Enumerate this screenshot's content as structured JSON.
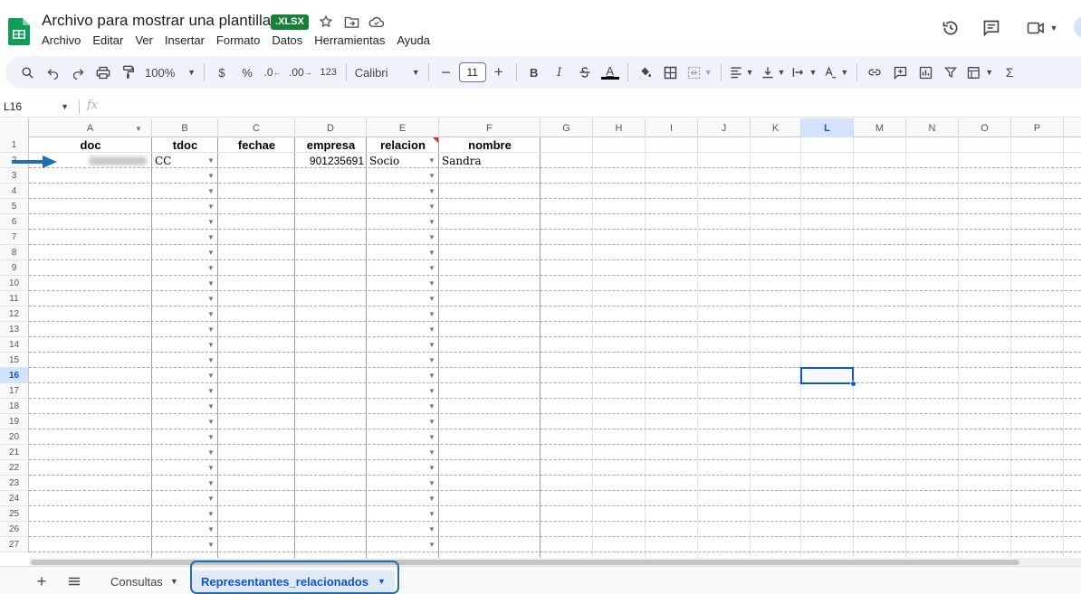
{
  "window": {
    "doc_title": "Archivo para mostrar una plantilla",
    "format_badge": "XLSX"
  },
  "menu": [
    "Archivo",
    "Editar",
    "Ver",
    "Insertar",
    "Formato",
    "Datos",
    "Herramientas",
    "Ayuda"
  ],
  "toolbar": {
    "zoom": "100%",
    "currency": "$",
    "percent": "%",
    "decrease_decimals": ".0",
    "increase_decimals": ".00",
    "number_format": "123",
    "font": "Calibri",
    "font_size": "11",
    "bold": "B",
    "italic": "I",
    "text_color": "A",
    "sum": "Σ"
  },
  "formula_bar": {
    "name_box": "L16",
    "fx": "fx"
  },
  "columns": [
    "A",
    "B",
    "C",
    "D",
    "E",
    "F",
    "G",
    "H",
    "I",
    "J",
    "K",
    "L",
    "M",
    "N",
    "O",
    "P"
  ],
  "selected_column": "L",
  "selected_row": "16",
  "rows": [
    "1",
    "2",
    "3",
    "4",
    "5",
    "6",
    "7",
    "8",
    "9",
    "10",
    "11",
    "12",
    "13",
    "14",
    "15",
    "16",
    "17",
    "18",
    "19",
    "20",
    "21",
    "22",
    "23",
    "24",
    "25",
    "26",
    "27"
  ],
  "headers": {
    "A": "doc",
    "B": "tdoc",
    "C": "fechae",
    "D": "empresa",
    "E": "relacion",
    "F": "nombre"
  },
  "row2": {
    "B": "CC",
    "D": "901235691",
    "E": "Socio",
    "F": "Sandra"
  },
  "sheets": {
    "tabs": [
      "Consultas",
      "Representantes_relacionados"
    ],
    "active": "Representantes_relacionados"
  },
  "colors": {
    "accent": "#0b57d0",
    "sheets_green": "#188038",
    "toolbar_bg": "#eef2f9",
    "annotation_blue": "#1f6fb5"
  }
}
